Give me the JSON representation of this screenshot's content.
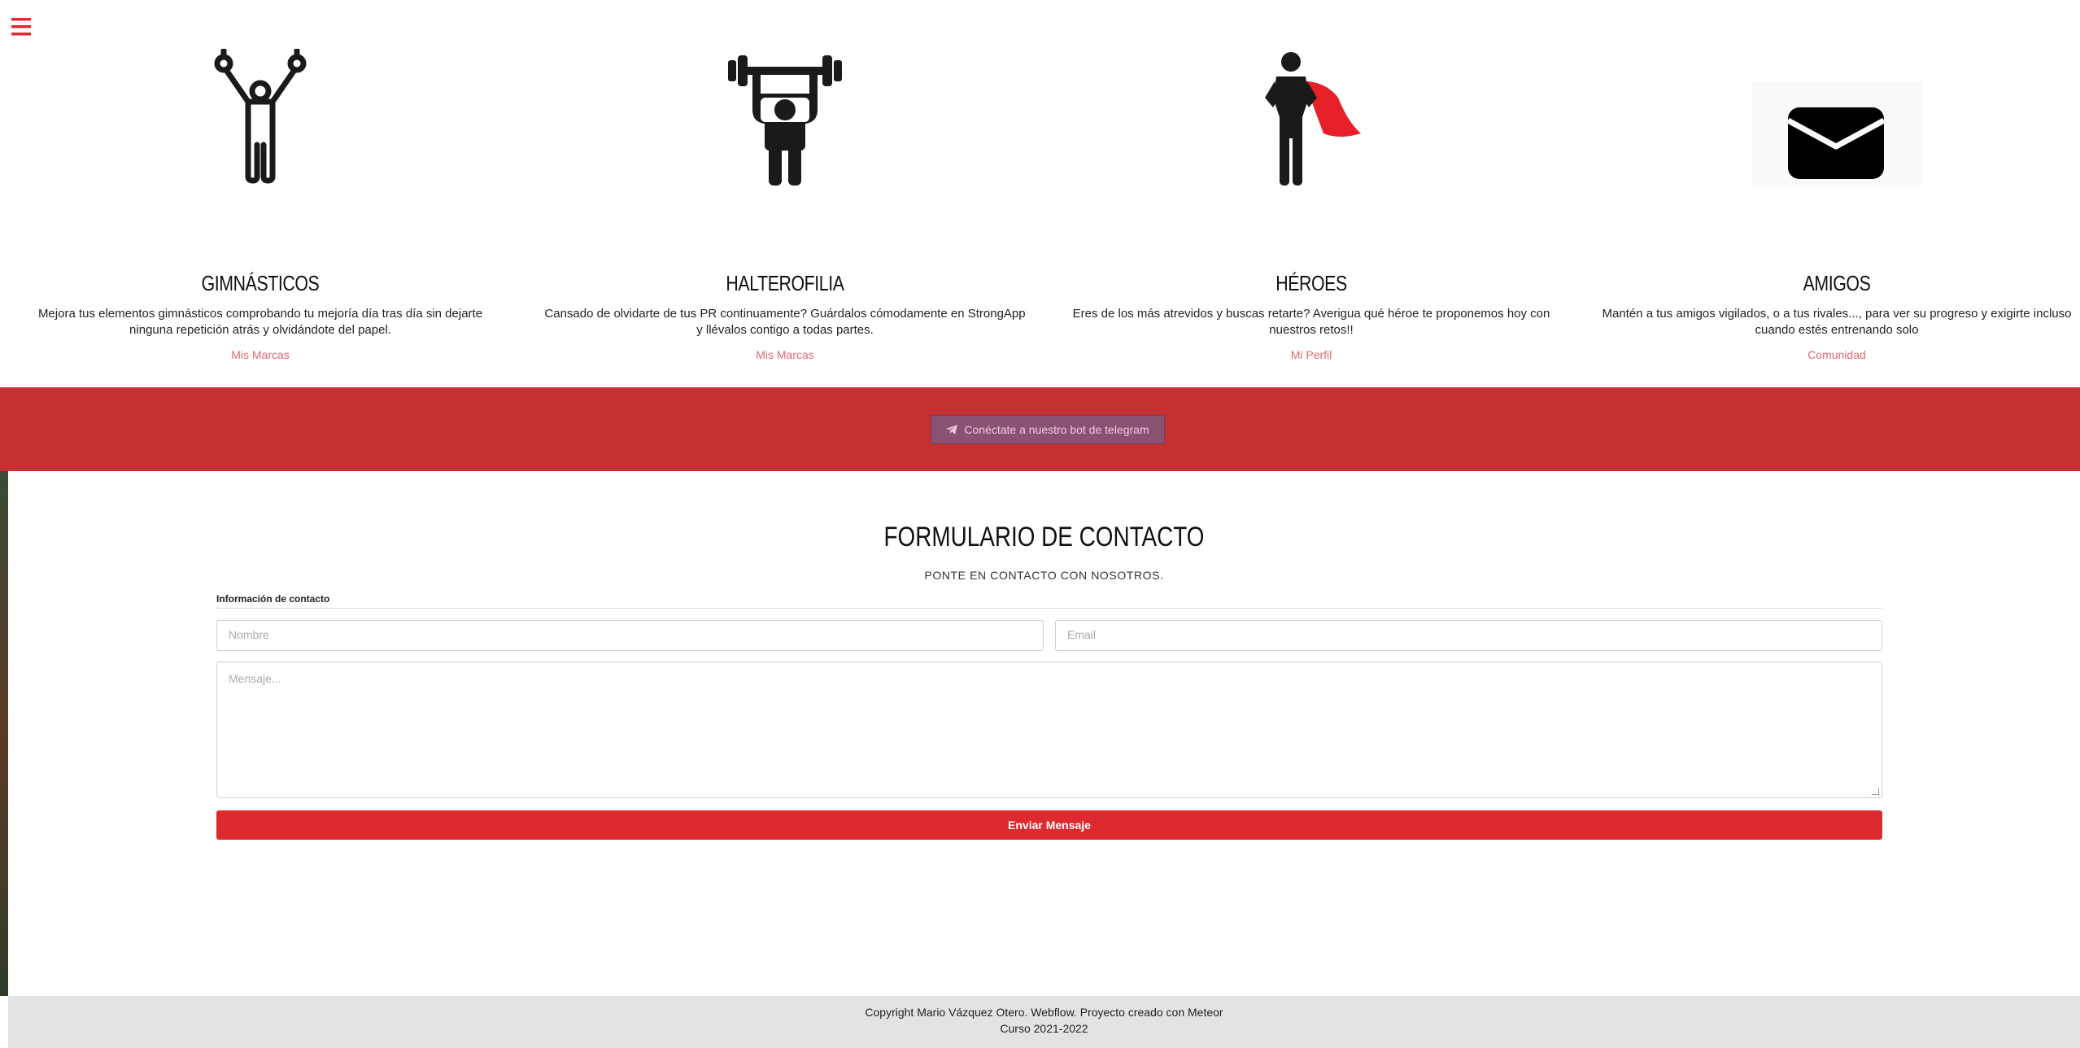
{
  "nav": {
    "menu_icon": "hamburger-icon"
  },
  "features": [
    {
      "icon": "gymnast-rings-icon",
      "title": "GIMNÁSTICOS",
      "text": "Mejora tus elementos gimnásticos comprobando tu mejoría día tras día sin dejarte ninguna repetición atrás y olvidándote del papel.",
      "link": "Mis Marcas"
    },
    {
      "icon": "weightlifter-icon",
      "title": "HALTEROFILIA",
      "text": "Cansado de olvidarte de tus PR continuamente? Guárdalos cómodamente en StrongApp y llévalos contigo a todas partes.",
      "link": "Mis Marcas"
    },
    {
      "icon": "superhero-icon",
      "title": "HÉROES",
      "text": "Eres de los más atrevidos y buscas retarte? Averigua qué héroe te proponemos hoy con nuestros retos!!",
      "link": "Mi Perfil"
    },
    {
      "icon": "envelope-icon",
      "title": "AMIGOS",
      "text": "Mantén a tus amigos vigilados, o a tus rivales..., para ver su progreso y exigirte incluso cuando estés entrenando solo",
      "link": "Comunidad"
    }
  ],
  "telegram": {
    "label": "Conéctate a nuestro bot de telegram",
    "icon": "telegram-plane-icon"
  },
  "contact": {
    "title": "FORMULARIO DE CONTACTO",
    "subtitle": "PONTE EN CONTACTO CON NOSOTROS.",
    "info_label": "Información de contacto",
    "name_placeholder": "Nombre",
    "email_placeholder": "Email",
    "message_placeholder": "Mensaje...",
    "submit_label": "Enviar Mensaje"
  },
  "footer": {
    "line1": "Copyright Mario Vázquez Otero. Webflow. Proyecto creado con Meteor",
    "line2": "Curso 2021-2022"
  },
  "colors": {
    "accent": "#dc2a2f",
    "band": "#c63033",
    "link": "#e0676e",
    "cape": "#e8202a"
  }
}
